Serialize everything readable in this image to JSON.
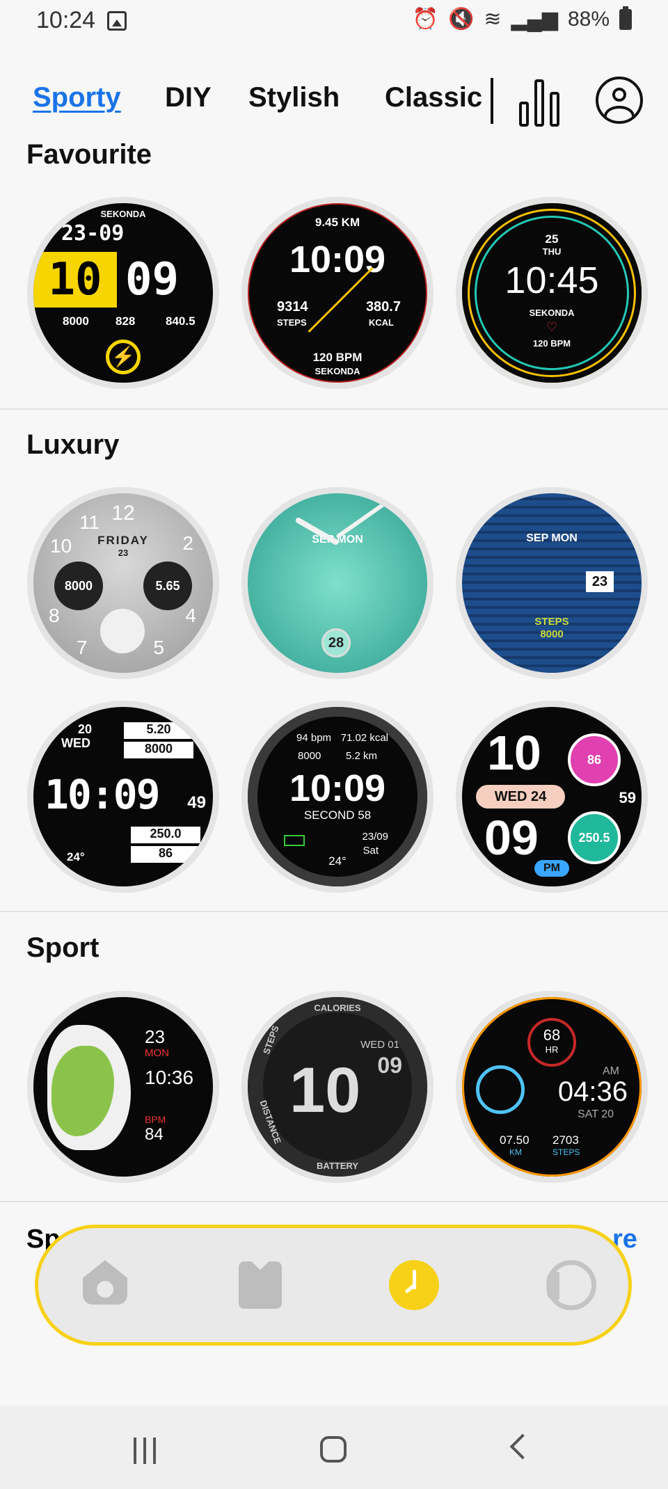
{
  "status_bar": {
    "time": "10:24",
    "battery": "88%",
    "icons": [
      "image-icon",
      "alarm-icon",
      "mute-icon",
      "wifi-icon",
      "signal-icon",
      "battery-icon"
    ]
  },
  "tabs": [
    {
      "label": "Sporty",
      "active": true
    },
    {
      "label": "DIY",
      "active": false
    },
    {
      "label": "Stylish",
      "active": false
    },
    {
      "label": "Classic",
      "active": false
    }
  ],
  "sections": {
    "favourite": {
      "title": "Favourite",
      "faces": [
        {
          "brand": "SEKONDA",
          "date": "23-09",
          "hour": "10",
          "minute": "09",
          "steps": "8000",
          "heart": "828",
          "calories": "840.5"
        },
        {
          "km": "9.45 KM",
          "time": "10:09",
          "steps": "9314",
          "steps_label": "STEPS",
          "kcal": "380.7",
          "kcal_label": "KCAL",
          "bpm": "120 BPM",
          "brand": "SEKONDA"
        },
        {
          "day": "25",
          "weekday": "THU",
          "time": "10:45",
          "brand": "SEKONDA",
          "bpm": "120 BPM"
        }
      ]
    },
    "luxury": {
      "title": "Luxury",
      "faces": [
        {
          "day": "FRIDAY",
          "date": "23",
          "left": "8000",
          "right": "5.65",
          "numbers": [
            "12",
            "11",
            "2",
            "10",
            "8",
            "4",
            "7",
            "5"
          ]
        },
        {
          "logo": "SEP MON",
          "date": "28"
        },
        {
          "logo": "SEP MON",
          "date": "23",
          "steps_label": "STEPS",
          "steps": "8000"
        },
        {
          "date": "20",
          "weekday": "WED",
          "top1": "5.20",
          "top2": "8000",
          "time": "10:09",
          "seconds": "49",
          "temp": "24°",
          "bottom1": "250.0",
          "bottom2": "86"
        },
        {
          "bpm": "94 bpm",
          "kcal": "71.02 kcal",
          "steps": "8000",
          "km": "5.2 km",
          "time": "10:09",
          "second": "SECOND 58",
          "temp": "24°",
          "date": "23/09",
          "weekday": "Sat"
        },
        {
          "hour": "10",
          "minute": "09",
          "date": "WED 24",
          "heart": "86",
          "seconds": "59",
          "calories": "250.5",
          "ampm": "PM"
        }
      ]
    },
    "sport": {
      "title": "Sport",
      "faces": [
        {
          "date": "23",
          "weekday": "MON",
          "time": "10:36",
          "bpm_label": "BPM",
          "bpm": "84"
        },
        {
          "calories_label": "CALORIES",
          "steps_label": "STEPS",
          "distance_label": "DISTANCE",
          "battery_label": "BATTERY",
          "date": "WED 01",
          "hour": "10",
          "minute": "09"
        },
        {
          "hr": "68",
          "hr_label": "HR",
          "ampm": "AM",
          "time": "04:36",
          "date": "SAT 20",
          "km": "07.50",
          "km_label": "KM",
          "steps": "2703",
          "steps_label": "STEPS"
        }
      ]
    }
  },
  "peek": {
    "left": "Sp",
    "right": "re"
  },
  "bottom_nav": [
    "home-icon",
    "vest-icon",
    "watch-face-icon",
    "watch-icon"
  ],
  "colors": {
    "accent": "#1a73e8",
    "nav_highlight": "#f7d117"
  }
}
